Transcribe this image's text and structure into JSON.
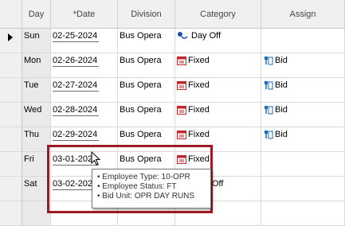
{
  "columns": [
    "Day",
    "*Date",
    "Division",
    "Category",
    "Assign"
  ],
  "rows": [
    {
      "day": "Sun",
      "date": "02-25-2024",
      "division": "Bus Opera",
      "category": "Day Off",
      "category_icon": "day-off-icon",
      "assign": ""
    },
    {
      "day": "Mon",
      "date": "02-26-2024",
      "division": "Bus Opera",
      "category": "Fixed",
      "category_icon": "calendar-icon",
      "assign": "Bid"
    },
    {
      "day": "Tue",
      "date": "02-27-2024",
      "division": "Bus Opera",
      "category": "Fixed",
      "category_icon": "calendar-icon",
      "assign": "Bid"
    },
    {
      "day": "Wed",
      "date": "02-28-2024",
      "division": "Bus Opera",
      "category": "Fixed",
      "category_icon": "calendar-icon",
      "assign": "Bid"
    },
    {
      "day": "Thu",
      "date": "02-29-2024",
      "division": "Bus Opera",
      "category": "Fixed",
      "category_icon": "calendar-icon",
      "assign": "Bid"
    },
    {
      "day": "Fri",
      "date": "03-01-2024",
      "division": "Bus Opera",
      "category": "Fixed",
      "category_icon": "calendar-icon",
      "assign": ""
    },
    {
      "day": "Sat",
      "date": "03-02-2024",
      "division": "",
      "category": "Off",
      "category_icon": "",
      "assign": ""
    }
  ],
  "tooltip": {
    "lines": [
      "Employee Type: 10-OPR",
      "Employee Status: FT",
      "Bid Unit: OPR DAY RUNS"
    ]
  },
  "colors": {
    "highlight_border": "#a01a22",
    "header_bg": "#f0f0f0",
    "accent": "#1e6bb8"
  }
}
